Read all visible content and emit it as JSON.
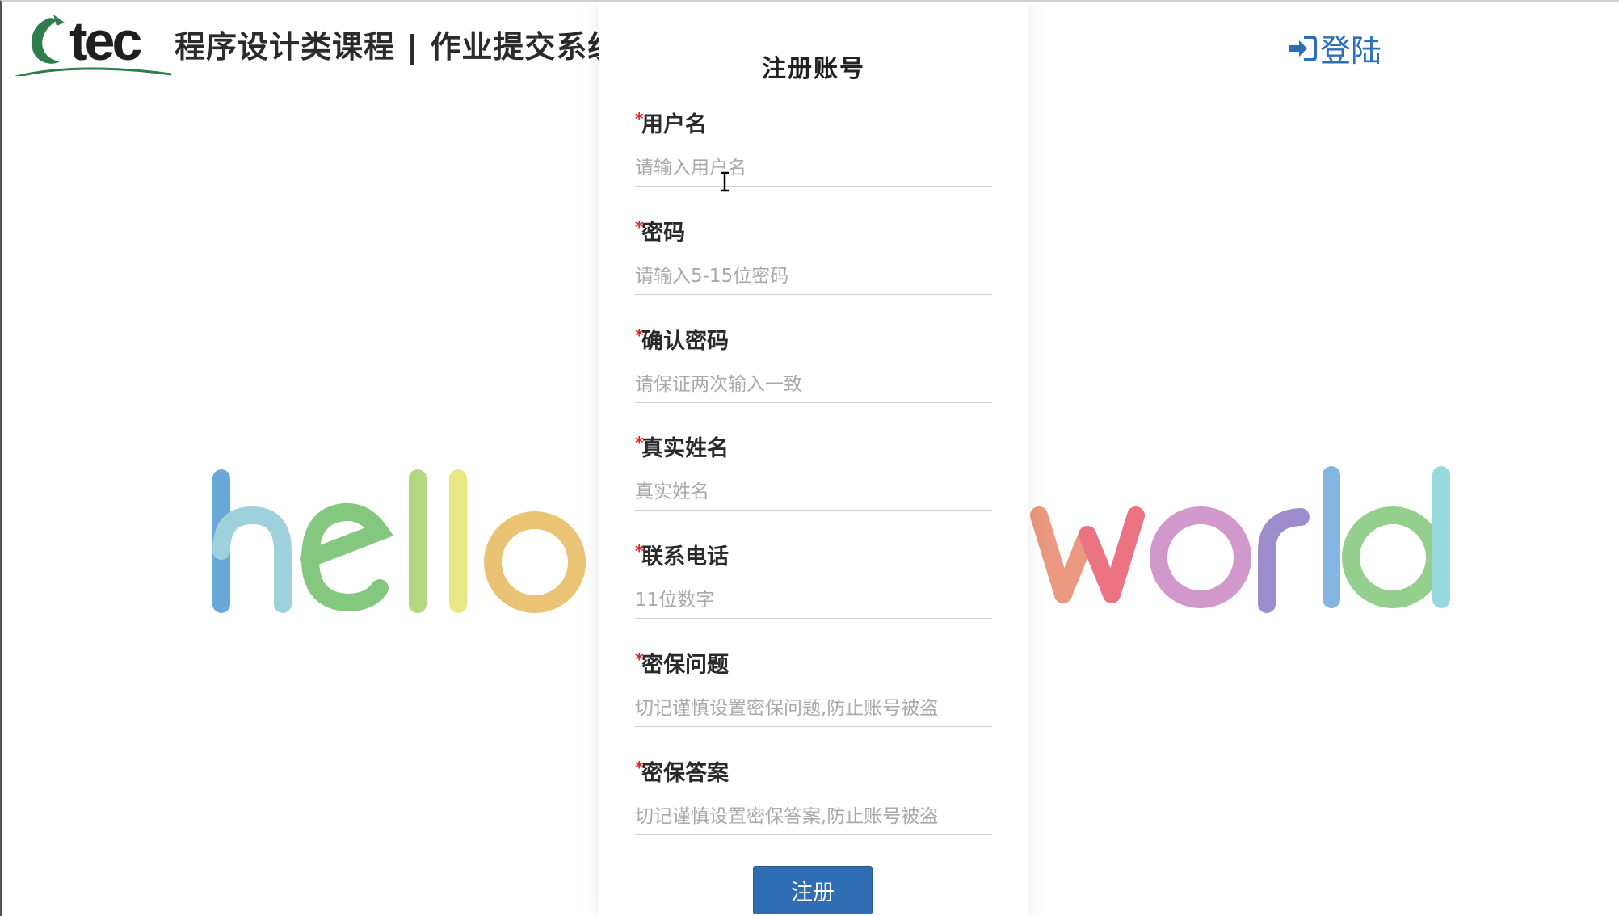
{
  "header": {
    "logo_text": "tec",
    "system_title": "程序设计类课程 | 作业提交系统",
    "login_label": "登陆"
  },
  "decor": {
    "left_word": "hello",
    "right_word": "world"
  },
  "form": {
    "title": "注册账号",
    "required_mark": "*",
    "fields": [
      {
        "label": "用户名",
        "placeholder": "请输入用户名"
      },
      {
        "label": "密码",
        "placeholder": "请输入5-15位密码"
      },
      {
        "label": "确认密码",
        "placeholder": "请保证两次输入一致"
      },
      {
        "label": "真实姓名",
        "placeholder": "真实姓名"
      },
      {
        "label": "联系电话",
        "placeholder": "11位数字"
      },
      {
        "label": "密保问题",
        "placeholder": "切记谨慎设置密保问题,防止账号被盗"
      },
      {
        "label": "密保答案",
        "placeholder": "切记谨慎设置密保答案,防止账号被盗"
      }
    ],
    "submit_label": "注册"
  },
  "colors": {
    "accent": "#2f6db4",
    "link": "#2a6fb8",
    "required": "#d9262b",
    "logo_green": "#2f7d4a"
  }
}
